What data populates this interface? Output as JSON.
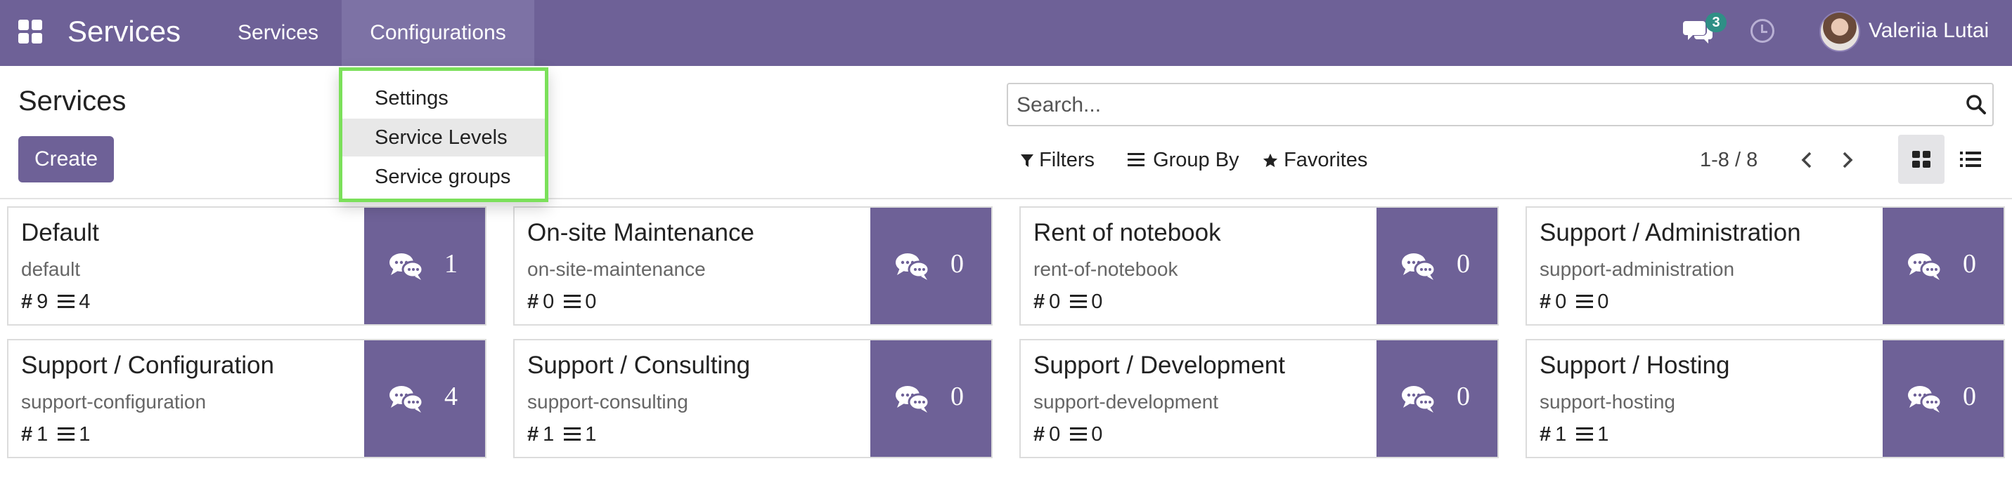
{
  "navbar": {
    "brand": "Services",
    "menu": [
      "Services",
      "Configurations"
    ],
    "chat_badge": "3",
    "user_name": "Valeriia Lutai"
  },
  "control": {
    "title": "Services",
    "create_label": "Create",
    "search_placeholder": "Search...",
    "filters_label": "Filters",
    "groupby_label": "Group By",
    "favorites_label": "Favorites",
    "pager": "1-8 / 8"
  },
  "dropdown": {
    "items": [
      "Settings",
      "Service Levels",
      "Service groups"
    ],
    "highlighted": "Service Levels"
  },
  "cards": [
    {
      "name": "Default",
      "code": "default",
      "hash": "9",
      "lines": "4",
      "count": "1"
    },
    {
      "name": "On-site Maintenance",
      "code": "on-site-maintenance",
      "hash": "0",
      "lines": "0",
      "count": "0"
    },
    {
      "name": "Rent of notebook",
      "code": "rent-of-notebook",
      "hash": "0",
      "lines": "0",
      "count": "0"
    },
    {
      "name": "Support / Administration",
      "code": "support-administration",
      "hash": "0",
      "lines": "0",
      "count": "0"
    },
    {
      "name": "Support / Configuration",
      "code": "support-configuration",
      "hash": "1",
      "lines": "1",
      "count": "4"
    },
    {
      "name": "Support / Consulting",
      "code": "support-consulting",
      "hash": "1",
      "lines": "1",
      "count": "0"
    },
    {
      "name": "Support / Development",
      "code": "support-development",
      "hash": "0",
      "lines": "0",
      "count": "0"
    },
    {
      "name": "Support / Hosting",
      "code": "support-hosting",
      "hash": "1",
      "lines": "1",
      "count": "0"
    }
  ],
  "colors": {
    "brand": "#6e6197",
    "badge": "#2f8f86",
    "highlight_border": "#7be05a"
  }
}
